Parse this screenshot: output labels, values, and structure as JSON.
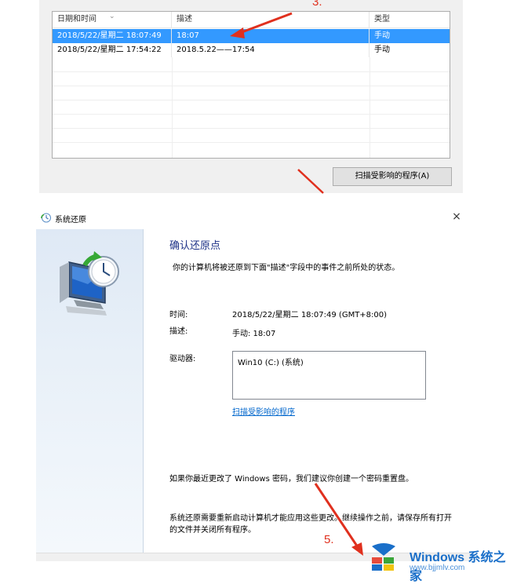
{
  "restore_points_list": {
    "columns": [
      "日期和时间",
      "描述",
      "类型"
    ],
    "rows": [
      {
        "datetime": "2018/5/22/星期二 18:07:49",
        "description": "18:07",
        "type": "手动",
        "selected": true
      },
      {
        "datetime": "2018/5/22/星期二 17:54:22",
        "description": "2018.5.22——17:54",
        "type": "手动",
        "selected": false
      }
    ],
    "scan_button_label": "扫描受影响的程序(A)"
  },
  "annotations": {
    "step3": "3.",
    "step5": "5.",
    "arrow_color": "#e0301e"
  },
  "dialog": {
    "title": "系统还原",
    "close_glyph": "×",
    "heading": "确认还原点",
    "description": "你的计算机将被还原到下面\"描述\"字段中的事件之前所处的状态。",
    "time_label": "时间:",
    "time_value": "2018/5/22/星期二 18:07:49 (GMT+8:00)",
    "desc_label": "描述:",
    "desc_value": "手动: 18:07",
    "drives_label": "驱动器:",
    "drives": [
      "Win10 (C:) (系统)"
    ],
    "scan_link": "扫描受影响的程序",
    "password_note": "如果你最近更改了 Windows 密码，我们建议你创建一个密码重置盘。",
    "restart_note": "系统还原需要重新启动计算机才能应用这些更改。继续操作之前，请保存所有打开的文件并关闭所有程序。"
  },
  "watermark": {
    "brand": "Windows 系统之家",
    "url": "www.bjjmlv.com"
  },
  "colors": {
    "selection": "#3399ff",
    "heading": "#1e3287",
    "link": "#0066cc"
  }
}
